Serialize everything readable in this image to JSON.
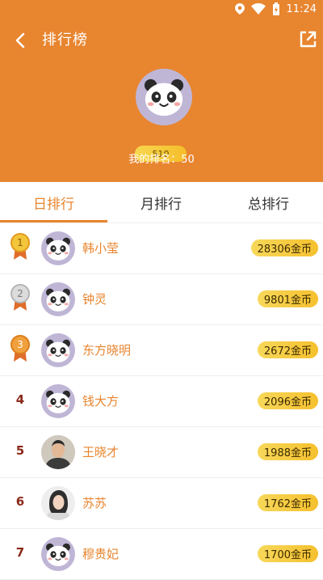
{
  "status_bar": {
    "time": "11:24"
  },
  "header": {
    "title": "排行榜",
    "score": "510",
    "my_rank_label": "我的排名：50"
  },
  "tabs": [
    {
      "label": "日排行",
      "active": true
    },
    {
      "label": "月排行",
      "active": false
    },
    {
      "label": "总排行",
      "active": false
    }
  ],
  "ranking": [
    {
      "rank": "1",
      "name": "韩小莹",
      "coins": "28306金币",
      "avatar": "panda"
    },
    {
      "rank": "2",
      "name": "钟灵",
      "coins": "9801金币",
      "avatar": "panda"
    },
    {
      "rank": "3",
      "name": "东方晓明",
      "coins": "2672金币",
      "avatar": "panda"
    },
    {
      "rank": "4",
      "name": "钱大方",
      "coins": "2096金币",
      "avatar": "panda"
    },
    {
      "rank": "5",
      "name": "王晓才",
      "coins": "1988金币",
      "avatar": "photo-man"
    },
    {
      "rank": "6",
      "name": "苏苏",
      "coins": "1762金币",
      "avatar": "photo-woman"
    },
    {
      "rank": "7",
      "name": "穆贵妃",
      "coins": "1700金币",
      "avatar": "panda"
    }
  ],
  "colors": {
    "accent": "#e8852f",
    "coin_pill": "#f6c531",
    "rank_num": "#8b2a1a"
  },
  "icons": [
    "back-arrow-icon",
    "share-icon",
    "location-icon",
    "wifi-icon",
    "battery-icon",
    "gold-medal-icon",
    "silver-medal-icon",
    "bronze-medal-icon",
    "panda-avatar-icon"
  ]
}
